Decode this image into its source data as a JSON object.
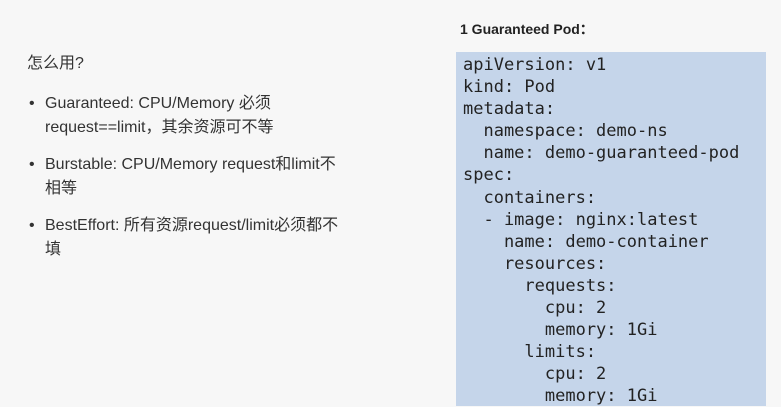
{
  "left": {
    "question": "怎么用?",
    "bullet_marker": "•",
    "bullets": [
      {
        "line1": "Guaranteed:  CPU/Memory 必须",
        "line2": "request==limit，其余资源可不等"
      },
      {
        "line1": "Burstable:  CPU/Memory request和limit不",
        "line2": "相等"
      },
      {
        "line1": "BestEffort:  所有资源request/limit必须都不",
        "line2": "填"
      }
    ]
  },
  "code": {
    "title": "1 Guaranteed Pod：",
    "lines": [
      "apiVersion: v1",
      "kind: Pod",
      "metadata:",
      "  namespace: demo-ns",
      "  name: demo-guaranteed-pod",
      "spec:",
      "  containers:",
      "  - image: nginx:latest",
      "    name: demo-container",
      "    resources:",
      "      requests:",
      "        cpu: 2",
      "        memory: 1Gi",
      "      limits:",
      "        cpu: 2",
      "        memory: 1Gi"
    ]
  }
}
